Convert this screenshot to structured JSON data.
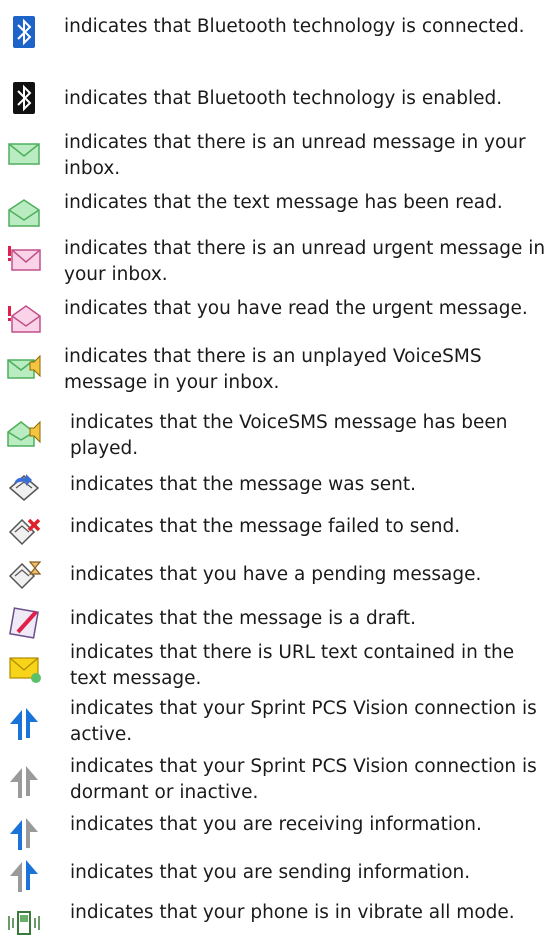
{
  "items": [
    {
      "icon": "bluetooth-connected-icon",
      "text": "indicates that Bluetooth technology is connected."
    },
    {
      "icon": "bluetooth-enabled-icon",
      "text": "indicates that Bluetooth technology is enabled."
    },
    {
      "icon": "unread-message-envelope-icon",
      "text": "indicates that there is an unread message in your inbox."
    },
    {
      "icon": "read-message-envelope-icon",
      "text": "indicates that the text message has been read."
    },
    {
      "icon": "unread-urgent-message-icon",
      "text": "indicates that there is an unread urgent message in your inbox."
    },
    {
      "icon": "read-urgent-message-icon",
      "text": "indicates that you have read the urgent message."
    },
    {
      "icon": "unplayed-voicesms-icon",
      "text": "indicates that there is an unplayed VoiceSMS message in your inbox."
    },
    {
      "icon": "played-voicesms-icon",
      "text": "indicates that the VoiceSMS message has been played."
    },
    {
      "icon": "message-sent-icon",
      "text": "indicates that the message was sent."
    },
    {
      "icon": "message-failed-icon",
      "text": "indicates that the message failed to send."
    },
    {
      "icon": "message-pending-icon",
      "text": "indicates that you have a pending message."
    },
    {
      "icon": "message-draft-icon",
      "text": "indicates that the message is a draft."
    },
    {
      "icon": "url-message-icon",
      "text": "indicates that there is URL text contained in the text message."
    },
    {
      "icon": "vision-active-icon",
      "text": "indicates that your Sprint PCS Vision connection is active."
    },
    {
      "icon": "vision-dormant-icon",
      "text": "indicates that your Sprint PCS Vision connection is dormant or inactive."
    },
    {
      "icon": "receiving-information-icon",
      "text": "indicates that you are receiving information."
    },
    {
      "icon": "sending-information-icon",
      "text": "indicates that you are sending information."
    },
    {
      "icon": "vibrate-all-icon",
      "text": "indicates that your phone is in vibrate all mode."
    }
  ],
  "colors": {
    "bluetooth_blue": "#1e63c8",
    "envelope_green": "#7bd18a",
    "urgent_red": "#e0204a",
    "vision_blue": "#1a73d9",
    "vision_gray": "#9a9a9a"
  }
}
